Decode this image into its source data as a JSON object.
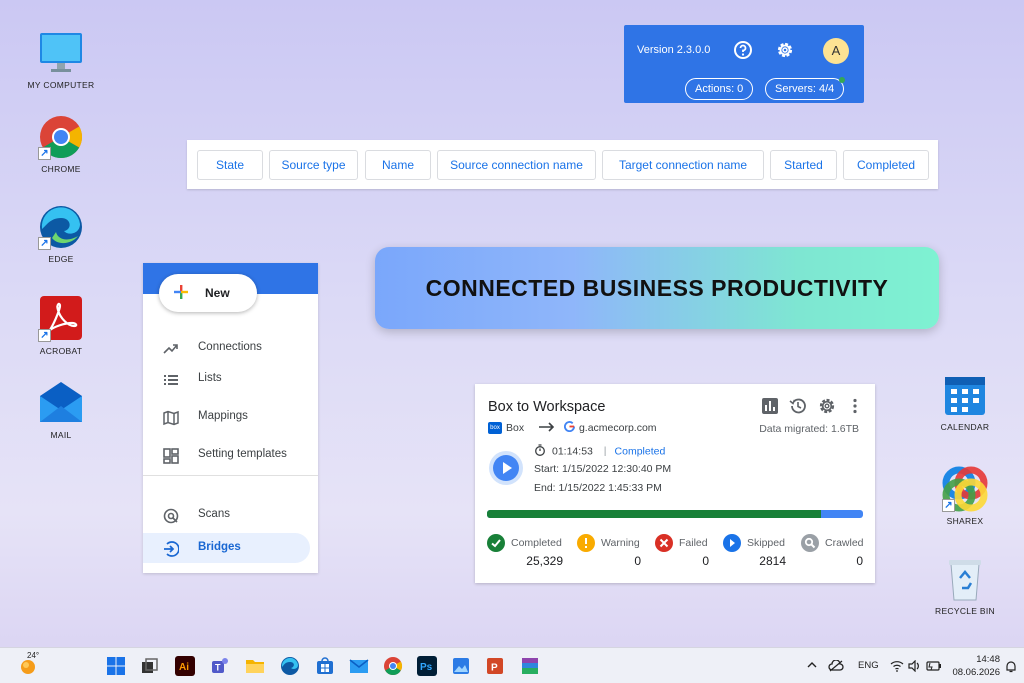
{
  "desktop": {
    "icons_left": [
      {
        "label": "MY COMPUTER",
        "icon": "monitor-icon"
      },
      {
        "label": "CHROME",
        "icon": "chrome-icon"
      },
      {
        "label": "EDGE",
        "icon": "edge-icon"
      },
      {
        "label": "ACROBAT",
        "icon": "acrobat-icon"
      },
      {
        "label": "MAIL",
        "icon": "mail-icon"
      }
    ],
    "icons_right": [
      {
        "label": "CALENDAR",
        "icon": "calendar-icon"
      },
      {
        "label": "SHAREX",
        "icon": "sharex-icon"
      },
      {
        "label": "RECYCLE BIN",
        "icon": "recycle-bin-icon"
      }
    ]
  },
  "header": {
    "version": "Version 2.3.0.0",
    "avatar_initial": "A",
    "actions": "Actions:  0",
    "servers": "Servers:  4/4",
    "accent": "#2f74e6"
  },
  "columns": [
    "State",
    "Source type",
    "Name",
    "Source connection name",
    "Target connection name",
    "Started",
    "Completed"
  ],
  "banner": {
    "text": "CONNECTED BUSINESS PRODUCTIVITY"
  },
  "sidebar": {
    "new_label": "New",
    "items": [
      {
        "label": "Connections",
        "icon": "trending-up-icon"
      },
      {
        "label": "Lists",
        "icon": "list-icon"
      },
      {
        "label": "Mappings",
        "icon": "map-icon"
      },
      {
        "label": "Setting templates",
        "icon": "template-icon"
      },
      {
        "label": "Scans",
        "icon": "scan-icon"
      },
      {
        "label": "Bridges",
        "icon": "bridge-icon"
      }
    ]
  },
  "job": {
    "title": "Box to Workspace",
    "source": "Box",
    "box_logo_text": "box",
    "target": "g.acmecorp.com",
    "data_migrated": "Data migrated: 1.6TB",
    "duration": "01:14:53",
    "separator": "|",
    "status": "Completed",
    "start": "Start: 1/15/2022 12:30:40 PM",
    "end": "End: 1/15/2022 1:45:33 PM",
    "progress_fraction": 0.887,
    "stats": [
      {
        "label": "Completed",
        "value": "25,329",
        "color": "#188038"
      },
      {
        "label": "Warning",
        "value": "0",
        "color": "#f9ab00"
      },
      {
        "label": "Failed",
        "value": "0",
        "color": "#d93025"
      },
      {
        "label": "Skipped",
        "value": "2814",
        "color": "#1a73e8"
      },
      {
        "label": "Crawled",
        "value": "0",
        "color": "#9aa0a6"
      }
    ]
  },
  "taskbar": {
    "weather": "24°",
    "lang": "ENG",
    "time": "14:48",
    "date": "08.06.2026"
  }
}
